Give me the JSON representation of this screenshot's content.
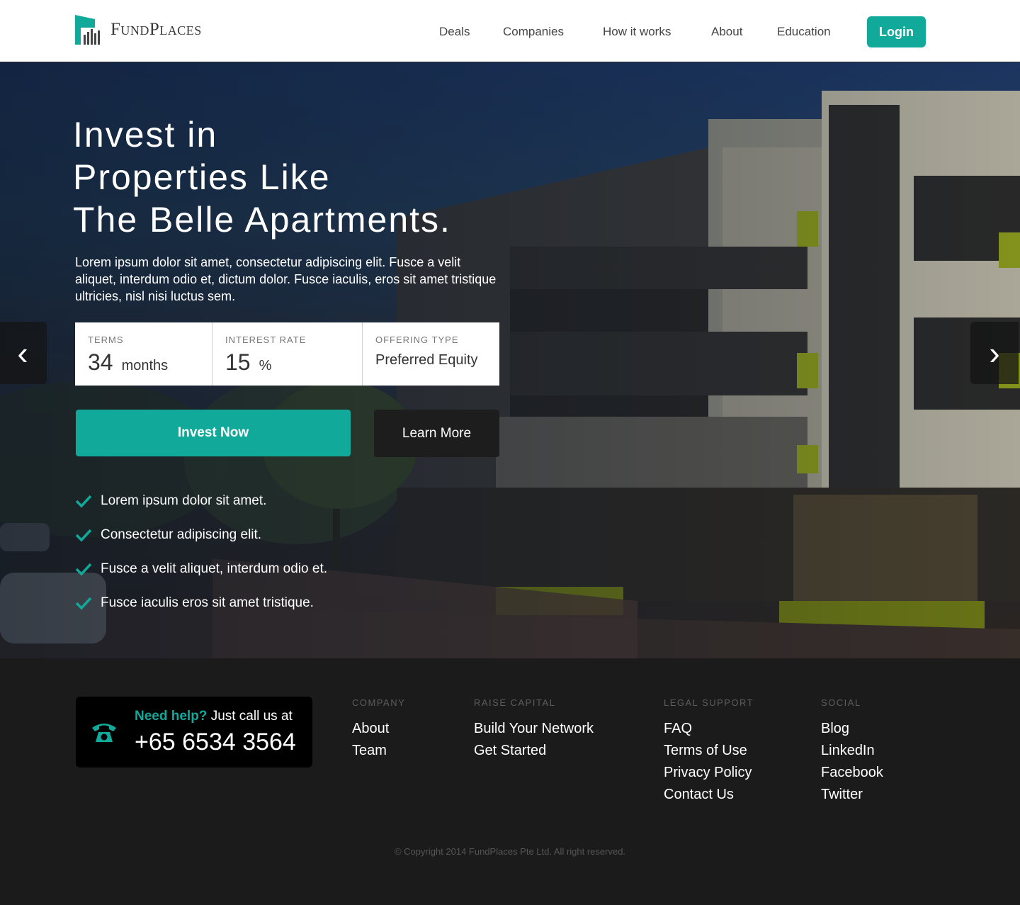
{
  "brand": {
    "name": "FundPlaces",
    "accent": "#10a99a"
  },
  "nav": {
    "items": [
      "Deals",
      "Companies",
      "How it works",
      "About",
      "Education"
    ],
    "login_label": "Login"
  },
  "hero": {
    "title": "Invest in\nProperties Like\nThe Belle Apartments.",
    "description": "Lorem ipsum dolor sit amet, consectetur adipiscing elit. Fusce a velit aliquet, interdum odio et, dictum dolor. Fusce iaculis, eros sit amet tristique ultricies, nisl nisi luctus sem.",
    "stats": {
      "terms": {
        "label": "TERMS",
        "value": "34",
        "unit": "months"
      },
      "interest": {
        "label": "INTEREST RATE",
        "value": "15",
        "unit": "%"
      },
      "offering": {
        "label": "OFFERING TYPE",
        "value": "Preferred Equity"
      }
    },
    "invest_label": "Invest Now",
    "learn_label": "Learn More",
    "checklist": [
      "Lorem ipsum dolor sit amet.",
      "Consectetur adipiscing elit.",
      "Fusce a velit aliquet, interdum odio et.",
      "Fusce iaculis eros sit amet tristique."
    ],
    "prev_arrow": "‹",
    "next_arrow": "›"
  },
  "footer": {
    "help": {
      "accent": "Need help?",
      "text": "Just call us at",
      "phone": "+65 6534 3564"
    },
    "columns": [
      {
        "heading": "COMPANY",
        "links": [
          "About",
          "Team"
        ]
      },
      {
        "heading": "RAISE CAPITAL",
        "links": [
          "Build Your Network",
          "Get Started"
        ]
      },
      {
        "heading": "LEGAL SUPPORT",
        "links": [
          "FAQ",
          "Terms of Use",
          "Privacy Policy",
          "Contact Us"
        ]
      },
      {
        "heading": "SOCIAL",
        "links": [
          "Blog",
          "LinkedIn",
          "Facebook",
          "Twitter"
        ]
      }
    ],
    "copyright": "© Copyright 2014 FundPlaces Pte Ltd. All right reserved."
  }
}
